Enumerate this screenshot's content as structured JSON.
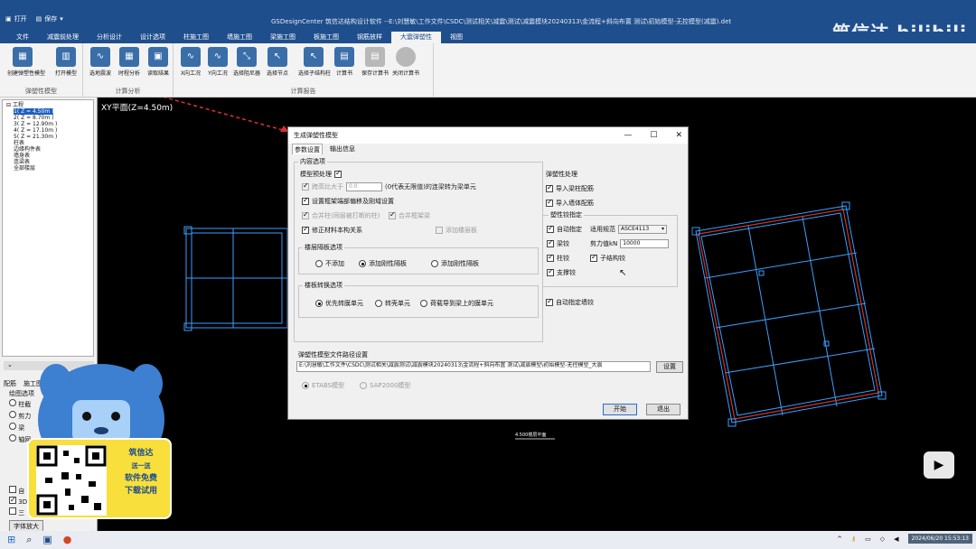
{
  "titlebar": {
    "open_label": "打开",
    "save_label": "保存",
    "title": "GSDesignCenter 筑信达结构设计软件 --E:\\刘慧敏\\工作文件\\CSDC\\测试相关\\减震\\测试\\减震模块20240313\\金流程+斜向布置 测试\\初始模型-无控模型(减震).det",
    "brand": "筑信达 bilibili"
  },
  "menu": [
    "文件",
    "减震前处理",
    "分析设计",
    "设计选项",
    "柱施工图",
    "墙施工图",
    "梁施工图",
    "板施工图",
    "钢筋放样",
    "大震弹塑性",
    "视图"
  ],
  "menu_active_index": 9,
  "ribbon": {
    "group1": {
      "label": "弹塑性模型",
      "buttons": [
        "创建弹塑性模型",
        "打开模型"
      ]
    },
    "group2": {
      "label": "计算分析",
      "buttons": [
        "选地震波",
        "时程分析",
        "读取结果"
      ]
    },
    "group3": {
      "label": "计算报告",
      "buttons": [
        "X向工况",
        "Y向工况",
        "选择阻尼器",
        "选择节点",
        "选择子结构柱",
        "计算书",
        "保存计算书",
        "关闭计算书"
      ]
    }
  },
  "tree": {
    "root": "工程",
    "floors": [
      "1( Z = 4.50m )",
      "2( Z = 8.70m )",
      "3( Z = 12.90m )",
      "4( Z = 17.10m )",
      "5( Z = 21.30m )"
    ],
    "items": [
      "柱表",
      "边缘构件表",
      "墙身表",
      "连梁表",
      "全部楼层"
    ]
  },
  "leftpanel": {
    "tabs": [
      "配筋",
      "施工图"
    ],
    "sub": "绘图选项",
    "radios": [
      "柱截",
      "剪力",
      "梁",
      "轴网"
    ],
    "checks": [
      "自",
      "3D",
      "三"
    ],
    "button": "字体放大"
  },
  "canvas": {
    "label": "XY平面(Z=4.50m)",
    "floor_tag": "4.500楼层平面"
  },
  "dialog": {
    "title": "生成弹塑性模型",
    "tabs": [
      "参数设置",
      "输出信息"
    ],
    "content_group": "内容选项",
    "preproc_label": "模型预处理",
    "span_ratio_label": "跨高比大于",
    "span_ratio_value": "0.0",
    "span_ratio_note": "(0代表无限值)的连梁转为梁单元",
    "opt1": "设置框架端部偏移及刚域设置",
    "opt2": "合并柱(同层被打断的柱)",
    "opt3": "合并框架梁",
    "opt4": "修正材料本构关系",
    "opt5": "添加楼层板",
    "floor_partition_group": "楼层隔板选项",
    "fp_opts": [
      "不添加",
      "添加刚性隔板",
      "添加刚性隔板"
    ],
    "slab_convert_group": "楼板转换选项",
    "sc_opts": [
      "优先转膜单元",
      "转壳单元",
      "荷载导到梁上的膜单元"
    ],
    "ep_group": "弹塑性处理",
    "import_beam": "导入梁柱配筋",
    "import_wall": "导入墙体配筋",
    "hinge_group": "塑性铰指定",
    "auto_assign": "自动指定",
    "code_label": "适用规范",
    "code_value": "ASCE4113",
    "beam_hinge": "梁铰",
    "shear_label": "剪力值kN",
    "shear_value": "10000",
    "col_hinge": "柱铰",
    "sub_col_hinge": "子结构铰",
    "brace_hinge": "支撑铰",
    "auto_wall_hinge": "自动指定墙铰",
    "path_group": "弹塑性模型文件路径设置",
    "path_value": "E:\\刘慧敏\\工作文件\\CSDC\\测试相关\\减震测试\\减震模块20240313\\金流程+斜向布置 测试\\减震模型\\初始模型-无控模型_大震",
    "settings_button": "设置",
    "format_opts": [
      "ETABS模型",
      "SAP2000模型"
    ],
    "start_button": "开始",
    "exit_button": "退出"
  },
  "qr": {
    "line1": "筑信达",
    "line2": "送一送",
    "line3": "软件免费",
    "line4": "下载试用"
  },
  "taskbar": {
    "clock": "2024/06/20 15:53:13"
  },
  "colors": {
    "title": "#1f4e8c",
    "ribbon": "#f3f3f3",
    "canvas": "#000000",
    "cad_blue": "#3aa0ff",
    "cad_red": "#cc3333"
  }
}
